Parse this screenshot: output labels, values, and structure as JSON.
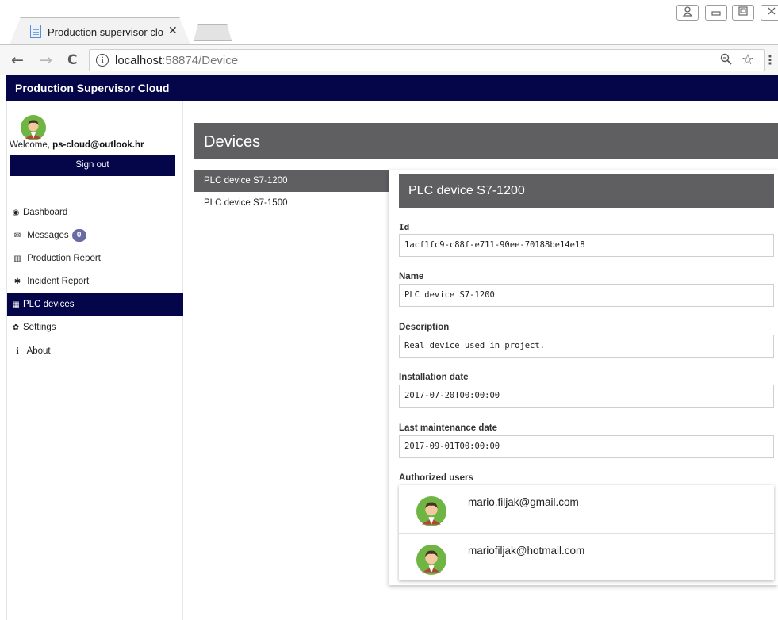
{
  "browser": {
    "tab_title": "Production supervisor clo",
    "tab_close": "✕",
    "url_host": "localhost",
    "url_rest": ":58874/Device",
    "nav_back": "←",
    "nav_forward": "→",
    "nav_reload": "C",
    "window_controls": [
      "person-icon",
      "minimize-icon",
      "maximize-icon",
      "close-icon"
    ]
  },
  "app": {
    "title": "Production Supervisor Cloud",
    "brand_color": "#05054a",
    "header_gray": "#5f5f62"
  },
  "sidebar": {
    "welcome_prefix": "Welcome, ",
    "user_email": "ps-cloud@outlook.hr",
    "sign_out": "Sign out",
    "items": [
      {
        "label": "Dashboard",
        "icon": "dashboard-icon",
        "glyph": "◉",
        "active": false
      },
      {
        "label": "Messages",
        "icon": "envelope-icon",
        "glyph": "✉",
        "active": false,
        "badge": "0"
      },
      {
        "label": "Production Report",
        "icon": "bar-chart-icon",
        "glyph": "▥",
        "active": false
      },
      {
        "label": "Incident Report",
        "icon": "incident-icon",
        "glyph": "✱",
        "active": false
      },
      {
        "label": "PLC devices",
        "icon": "database-icon",
        "glyph": "▦",
        "active": true
      },
      {
        "label": "Settings",
        "icon": "gear-icon",
        "glyph": "✿",
        "active": false
      },
      {
        "label": "About",
        "icon": "info-icon",
        "glyph": "i",
        "active": false
      }
    ]
  },
  "main": {
    "section_title": "Devices",
    "devices": [
      {
        "name": "PLC device S7-1200",
        "selected": true
      },
      {
        "name": "PLC device S7-1500",
        "selected": false
      }
    ]
  },
  "detail": {
    "title": "PLC device S7-1200",
    "fields": {
      "id": {
        "label": "Id",
        "value": "1acf1fc9-c88f-e711-90ee-70188be14e18"
      },
      "name": {
        "label": "Name",
        "value": "PLC device S7-1200"
      },
      "description": {
        "label": "Description",
        "value": "Real device used in project."
      },
      "installation_date": {
        "label": "Installation date",
        "value": "2017-07-20T00:00:00"
      },
      "last_maintenance_date": {
        "label": "Last maintenance date",
        "value": "2017-09-01T00:00:00"
      }
    },
    "authorized_users_label": "Authorized users",
    "authorized_users": [
      {
        "email": "mario.filjak@gmail.com"
      },
      {
        "email": "mariofiljak@hotmail.com"
      }
    ]
  }
}
